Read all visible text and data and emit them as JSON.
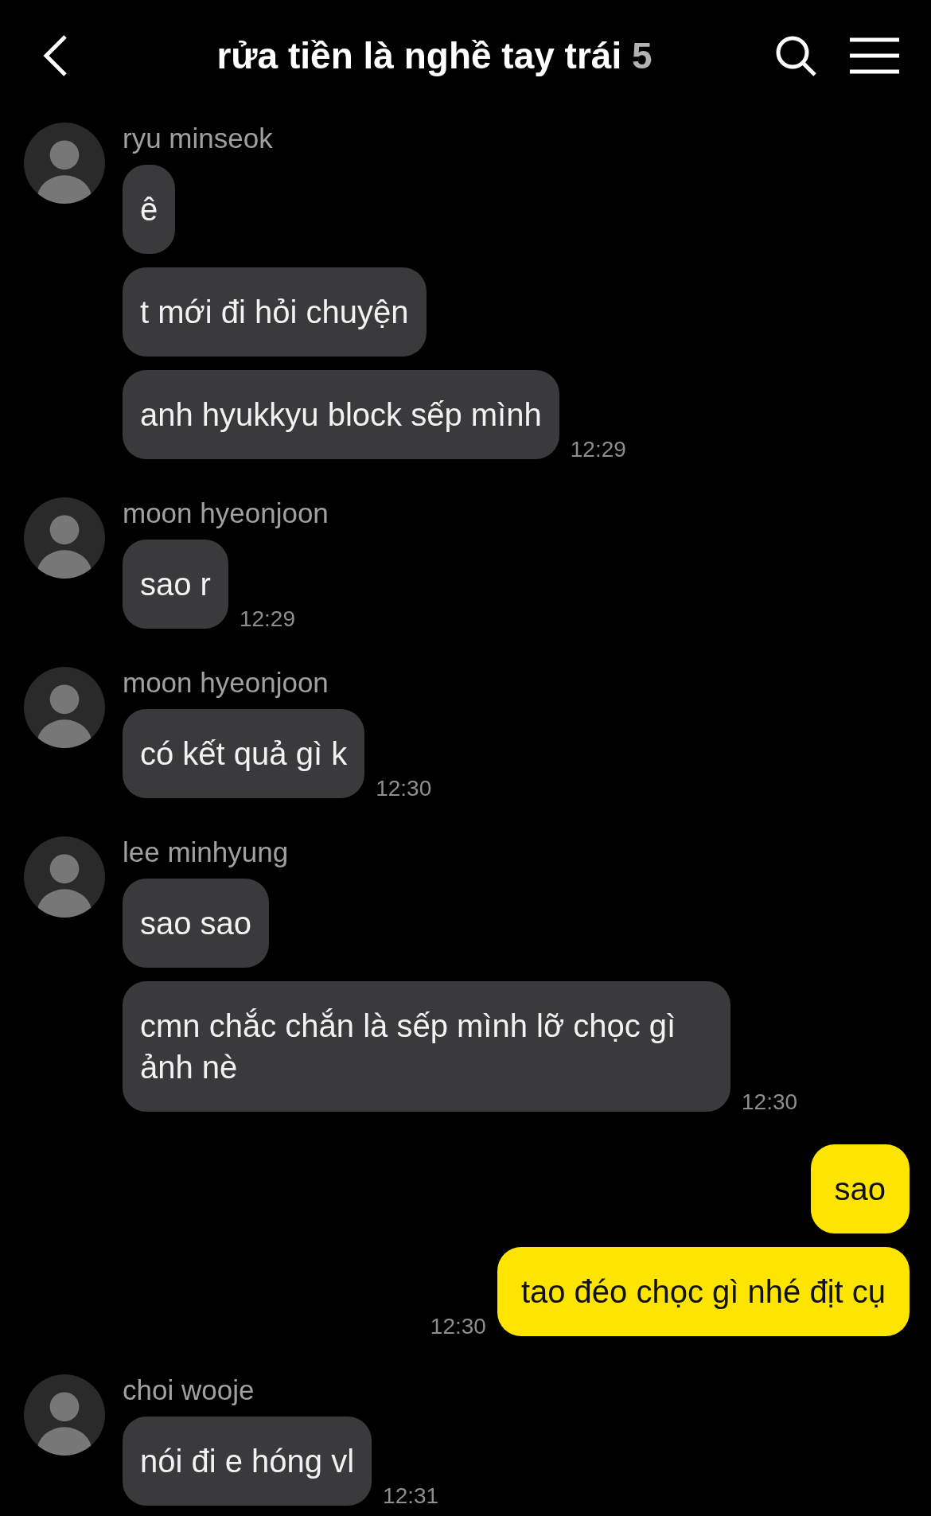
{
  "header": {
    "title": "rửa tiền là nghề tay trái",
    "member_count": "5"
  },
  "groups": [
    {
      "kind": "received",
      "sender": "ryu minseok",
      "messages": [
        "ê",
        "t mới đi hỏi chuyện",
        "anh hyukkyu block sếp mình"
      ],
      "time": "12:29"
    },
    {
      "kind": "received",
      "sender": "moon hyeonjoon",
      "messages": [
        "sao r"
      ],
      "time": "12:29"
    },
    {
      "kind": "received",
      "sender": "moon hyeonjoon",
      "messages": [
        "có kết quả gì k"
      ],
      "time": "12:30"
    },
    {
      "kind": "received",
      "sender": "lee minhyung",
      "messages": [
        "sao sao",
        "cmn chắc chắn là sếp mình lỡ chọc gì ảnh nè"
      ],
      "time": "12:30"
    },
    {
      "kind": "sent",
      "messages": [
        "sao",
        "tao đéo chọc gì nhé địt cụ"
      ],
      "time": "12:30"
    },
    {
      "kind": "received",
      "sender": "choi wooje",
      "messages": [
        "nói đi e hóng vl"
      ],
      "time": "12:31"
    }
  ]
}
